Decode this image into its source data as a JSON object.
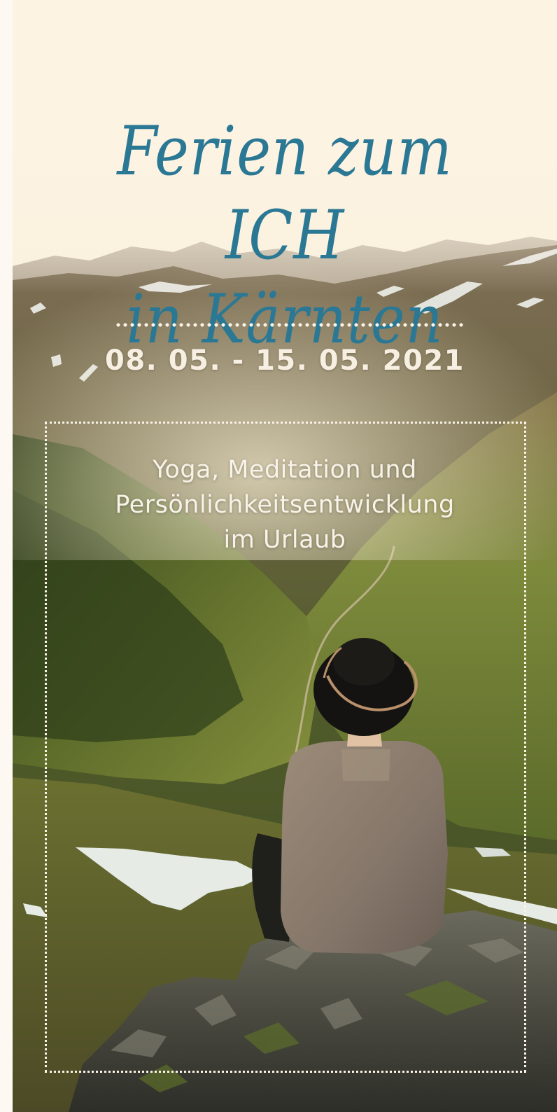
{
  "title": {
    "line1": "Ferien zum ICH",
    "line2": "in Kärnten"
  },
  "date_range": "08. 05. - 15. 05. 2021",
  "subtitle": {
    "line1": "Yoga, Meditation und",
    "line2": "Persönlichkeitsentwicklung",
    "line3": "im Urlaub"
  },
  "colors": {
    "background": "#fbf3e6",
    "title": "#2b7895",
    "text_light": "#f8f2e8"
  }
}
